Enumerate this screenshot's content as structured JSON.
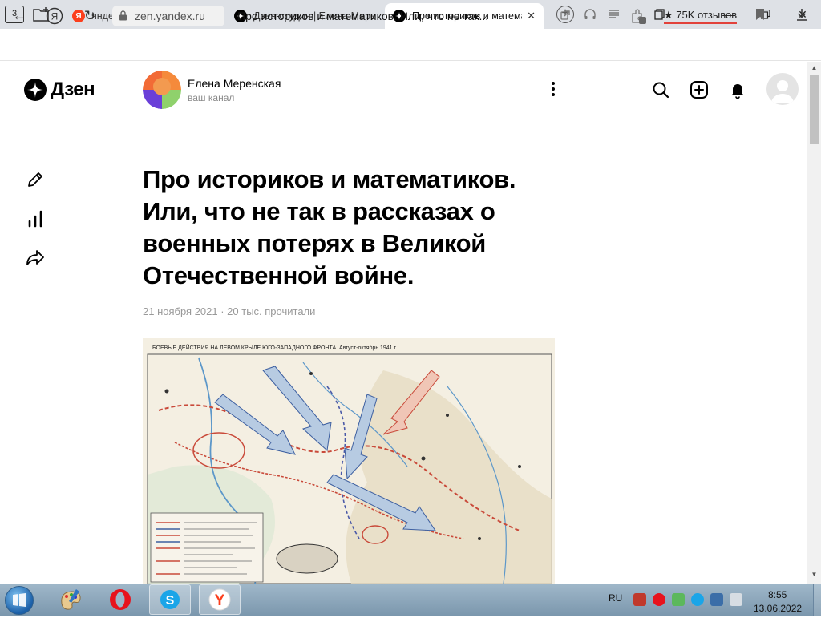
{
  "browser": {
    "tab_count": "3",
    "tabs": [
      {
        "title": "яндекс дзен — Яндекс: на",
        "favicon": "yandex-icon",
        "active": false
      },
      {
        "title": "Дзен-студия | Елена Мерен",
        "favicon": "zen-icon",
        "active": false
      },
      {
        "title": "Про историков и матема",
        "favicon": "zen-icon",
        "active": true
      }
    ],
    "address": {
      "domain": "zen.yandex.ru",
      "page_title": "Про историков и математиков. Или, что не так..."
    },
    "reviews_label": "75K отзывов",
    "extension_badge": "4"
  },
  "header": {
    "logo_text": "Дзен",
    "channel_name": "Елена Меренская",
    "channel_subtitle": "ваш канал"
  },
  "article": {
    "title": "Про историков и математиков. Или, что не так в рассказах о военных потерях в Великой Отечественной войне.",
    "meta": "21 ноября 2021 · 20 тыс. прочитали",
    "map_caption": "БОЕВЫЕ ДЕЙСТВИЯ НА ЛЕВОМ КРЫЛЕ ЮГО-ЗАПАДНОГО ФРОНТА. Август-октябрь 1941 г."
  },
  "taskbar": {
    "apps": [
      "paint-icon",
      "opera-icon",
      "skype-icon",
      "yandex-browser-icon"
    ],
    "language": "RU",
    "time": "8:55",
    "date": "13.06.2022"
  },
  "colors": {
    "tab_strip": "#dee1e6",
    "yandex_red": "#fc3f1d",
    "reviews_underline": "#e2423b",
    "meta_gray": "#999999",
    "taskbar": "#8ba6bb"
  }
}
